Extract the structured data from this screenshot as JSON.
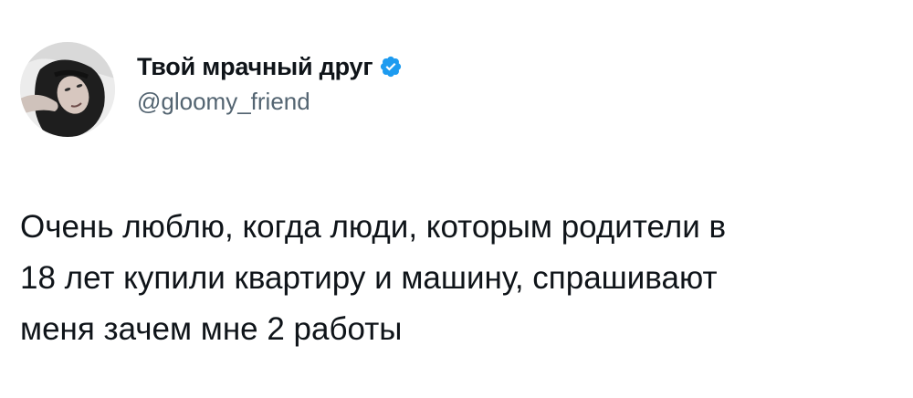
{
  "author": {
    "display_name": "Твой мрачный друг",
    "handle": "@gloomy_friend",
    "verified": true,
    "verified_color": "#1d9bf0"
  },
  "icons": {
    "avatar": "profile-photo",
    "verified": "verified-badge-icon"
  },
  "tweet": {
    "text": "Очень люблю, когда люди, которым родители в\n18 лет купили квартиру и машину, спрашивают\nменя зачем мне 2 работы"
  }
}
